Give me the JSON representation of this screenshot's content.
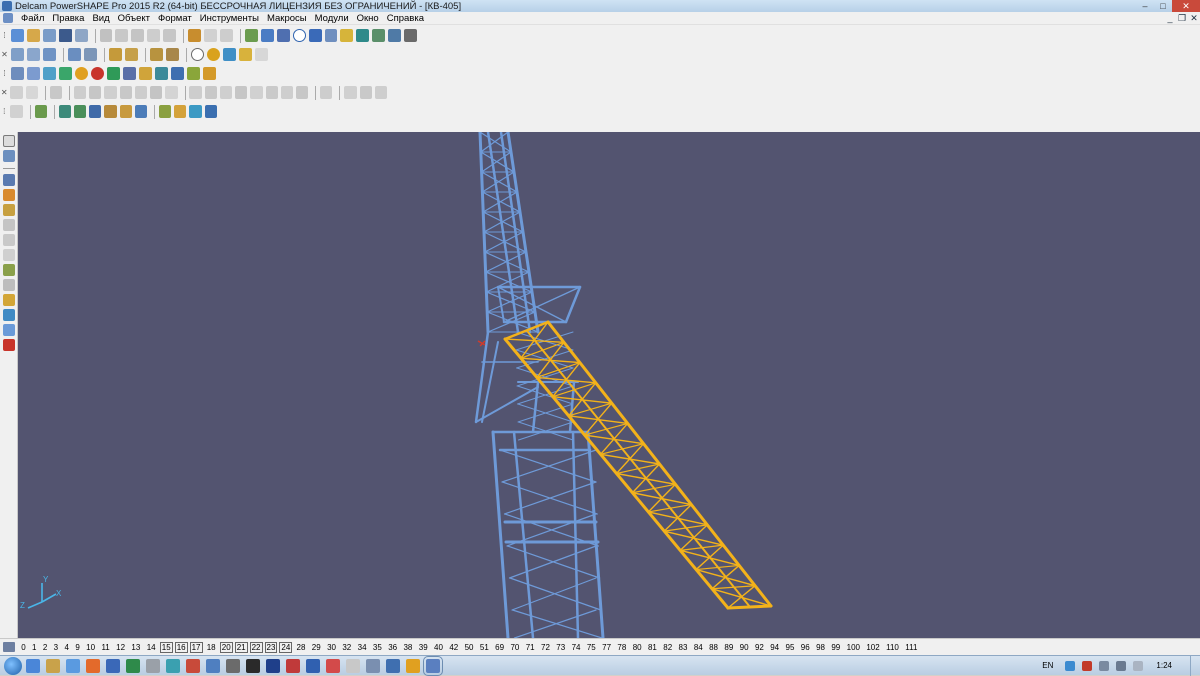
{
  "window": {
    "title": "Delcam PowerSHAPE Pro 2015 R2 (64-bit) БЕССРОЧНАЯ ЛИЦЕНЗИЯ БЕЗ ОГРАНИЧЕНИЙ - [КВ-405]",
    "min_glyph": "–",
    "max_glyph": "□",
    "close_glyph": "✕"
  },
  "menu": {
    "items": [
      "Файл",
      "Правка",
      "Вид",
      "Объект",
      "Формат",
      "Инструменты",
      "Макросы",
      "Модули",
      "Окно",
      "Справка"
    ],
    "mdi_min": "_",
    "mdi_restore": "❐",
    "mdi_close": "✕"
  },
  "colors": {
    "viewport_bg": "#535470",
    "tower": "#6e9ad8",
    "boom": "#f3b21a",
    "axis": "#4ab6e8",
    "marker": "#d23a2a"
  },
  "viewport": {
    "axis_y": "Y",
    "axis_x": "X",
    "axis_z": "Z"
  },
  "levels": {
    "items": [
      "0",
      "1",
      "2",
      "3",
      "4",
      "9",
      "10",
      "11",
      "12",
      "13",
      "14",
      "15",
      "16",
      "17",
      "18",
      "20",
      "21",
      "22",
      "23",
      "24",
      "28",
      "29",
      "30",
      "32",
      "34",
      "35",
      "36",
      "38",
      "39",
      "40",
      "42",
      "50",
      "51",
      "69",
      "70",
      "71",
      "72",
      "73",
      "74",
      "75",
      "77",
      "78",
      "80",
      "81",
      "82",
      "83",
      "84",
      "88",
      "89",
      "90",
      "92",
      "94",
      "95",
      "96",
      "98",
      "99",
      "100",
      "102",
      "110",
      "111"
    ],
    "boxed": [
      "15",
      "16",
      "17",
      "20",
      "21",
      "22",
      "23",
      "24"
    ]
  },
  "taskbar": {
    "language": "EN",
    "time": "1:24"
  }
}
